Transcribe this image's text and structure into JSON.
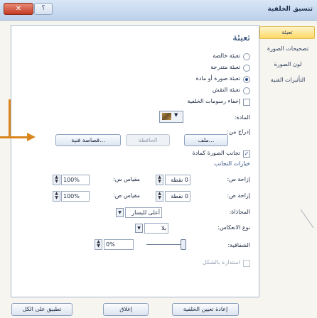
{
  "window": {
    "title": "تنسيق الخلفية",
    "close_glyph": "✕",
    "help_glyph": "؟"
  },
  "categories": [
    {
      "label": "تعبئة",
      "selected": true
    },
    {
      "label": "تصحيحات الصورة",
      "selected": false
    },
    {
      "label": "لون الصورة",
      "selected": false
    },
    {
      "label": "التأثيرات الفنية",
      "selected": false
    }
  ],
  "fill": {
    "section_title": "تعبئة",
    "options": [
      {
        "label": "تعبئة خالصة",
        "checked": false
      },
      {
        "label": "تعبئة متدرجة",
        "checked": false
      },
      {
        "label": "تعبئة صورة أو مادة",
        "checked": true
      },
      {
        "label": "تعبئة النقش",
        "checked": false
      }
    ],
    "hide_background": "إخفاء رسومات الخلفية",
    "texture_label": "المادة:",
    "insert_from": "إدراج من:",
    "btn_file": "ملف...",
    "btn_clipboard": "الحافظة",
    "btn_clipart": "قصاصة فنية...",
    "tile_checkbox": "تجانب الصورة كمادة",
    "tiling_options": "خيارات التجانب",
    "offset_x_label": "إزاحة س:",
    "offset_x_value": "0 نقطة",
    "scale_x_label": "مقياس س:",
    "scale_x_value": "100%",
    "offset_y_label": "إزاحة ص:",
    "offset_y_value": "0 نقطة",
    "scale_y_label": "مقياس ص:",
    "scale_y_value": "100%",
    "alignment_label": "المحاذاة:",
    "alignment_value": "أعلى لليسار",
    "mirror_label": "نوع الانعكاس:",
    "mirror_value": "بلا",
    "transparency_label": "الشفافية:",
    "transparency_value": "0%",
    "rotate_with_shape": "استدارة بالشكل"
  },
  "footer": {
    "reset": "إعادة تعيين الخلفية",
    "close": "إغلاق",
    "apply_all": "تطبيق على الكل"
  },
  "colors": {
    "annotation_arrow": "#d9861f",
    "selected_category": "#ffd965"
  }
}
